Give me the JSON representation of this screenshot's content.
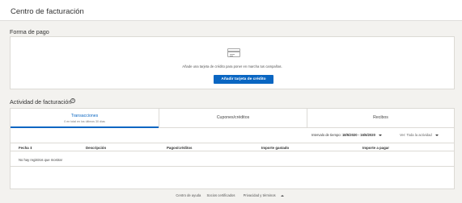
{
  "header": {
    "title": "Centro de facturación"
  },
  "payment": {
    "section_title": "Forma de pago",
    "description": "Añade una tarjeta de crédito para poner en marcha tus campañas.",
    "button_label": "Añadir tarjeta de crédito"
  },
  "activity": {
    "section_title": "Actividad de facturación",
    "info_glyph": "?",
    "tabs": [
      {
        "label": "Transacciones",
        "sub": "0 en total en los últimos 30 días"
      },
      {
        "label": "Cupones/créditos",
        "sub": ""
      },
      {
        "label": "Recibos",
        "sub": ""
      }
    ],
    "filters": {
      "range_label": "Intervalo de tiempo:",
      "range_value": "18/5/2020 - 16/6/2020",
      "view_label": "Ver: Toda la actividad"
    },
    "columns": [
      "Fecha",
      "Descripción",
      "Pagos/créditos",
      "Importe gastado",
      "Importe a pagar"
    ],
    "sort_glyph": "⇕",
    "empty_message": "No hay registros que mostrar"
  },
  "footer": {
    "links": [
      "Centro de ayuda",
      "Socios certificados",
      "Privacidad y términos"
    ]
  },
  "colors": {
    "accent": "#0a66c2",
    "background": "#f3f2ef"
  }
}
